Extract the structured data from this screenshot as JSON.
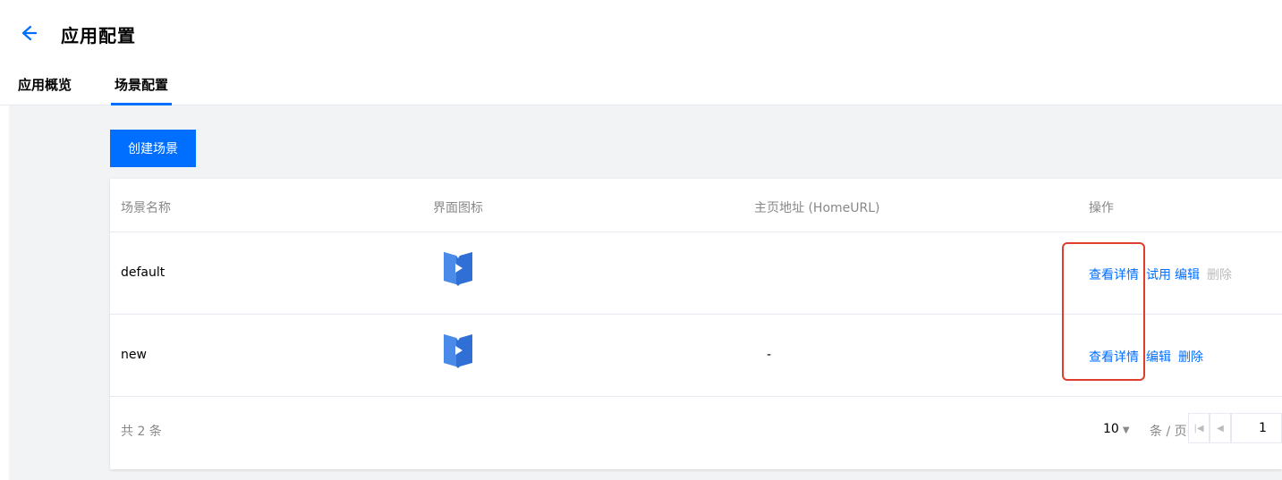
{
  "header": {
    "title": "应用配置"
  },
  "tabs": [
    {
      "label": "应用概览",
      "active": false
    },
    {
      "label": "场景配置",
      "active": true
    }
  ],
  "toolbar": {
    "create_label": "创建场景"
  },
  "table": {
    "columns": [
      "场景名称",
      "界面图标",
      "主页地址 (HomeURL)",
      "操作"
    ],
    "rows": [
      {
        "name": "default",
        "icon": "book-play-icon",
        "home_url": "",
        "actions": [
          {
            "label": "查看详情",
            "enabled": true
          },
          {
            "label": "试用",
            "enabled": true
          },
          {
            "label": "编辑",
            "enabled": true
          },
          {
            "label": "删除",
            "enabled": false
          }
        ]
      },
      {
        "name": "new",
        "icon": "book-play-icon",
        "home_url": "-",
        "actions": [
          {
            "label": "查看详情",
            "enabled": true
          },
          {
            "label": "编辑",
            "enabled": true
          },
          {
            "label": "删除",
            "enabled": true
          }
        ]
      }
    ]
  },
  "pagination": {
    "total_text": "共 2 条",
    "page_size": "10",
    "per_page_text": "条 / 页",
    "current_page": "1"
  },
  "colors": {
    "accent": "#006eff",
    "highlight": "#e03e2d",
    "icon_blue": "#2f6fd6"
  }
}
